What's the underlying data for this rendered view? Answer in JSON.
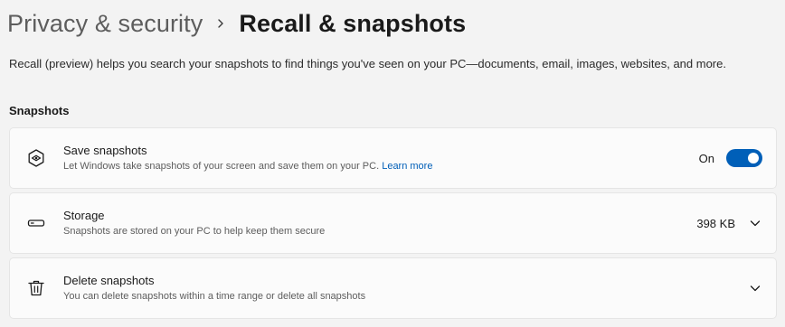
{
  "breadcrumb": {
    "parent": "Privacy & security",
    "current": "Recall & snapshots"
  },
  "description": "Recall (preview) helps you search your snapshots to find things you've seen on your PC—documents, email, images, websites, and more.",
  "snapshots_section": {
    "title": "Snapshots"
  },
  "save_snapshots": {
    "title": "Save snapshots",
    "subtitle": "Let Windows take snapshots of your screen and save them on your PC.",
    "link": "Learn more",
    "toggle_state": "On",
    "icon": "snapshot-icon"
  },
  "storage": {
    "title": "Storage",
    "subtitle": "Snapshots are stored on your PC to help keep them secure",
    "value": "398 KB",
    "icon": "drive-icon"
  },
  "delete_snapshots": {
    "title": "Delete snapshots",
    "subtitle": "You can delete snapshots within a time range or delete all snapshots",
    "icon": "trash-icon"
  },
  "colors": {
    "accent": "#005fb8",
    "background": "#f3f3f3",
    "card": "#fbfbfb"
  }
}
